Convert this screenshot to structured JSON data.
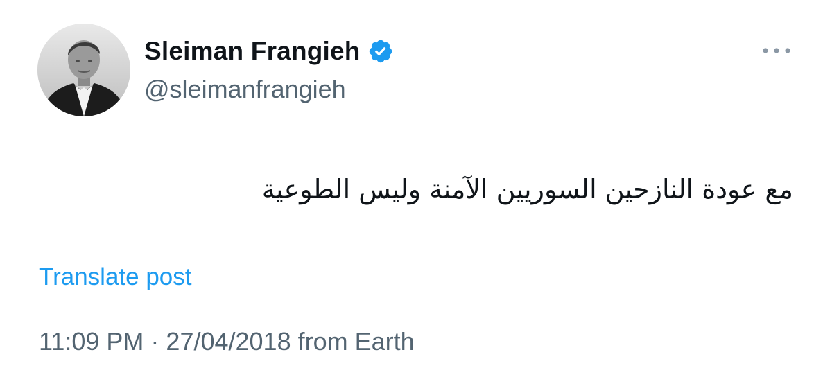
{
  "author": {
    "display_name": "Sleiman Frangieh",
    "handle": "@sleimanfrangieh",
    "verified": true
  },
  "icons": {
    "verified": "verified-badge-icon",
    "more": "more-options-icon",
    "avatar": "profile-photo"
  },
  "colors": {
    "accent": "#1d9bf0",
    "text": "#0f1419",
    "secondary_text": "#536471"
  },
  "tweet": {
    "text": "مع عودة النازحين السوريين الآمنة وليس الطوعية",
    "translate_label": "Translate post"
  },
  "meta": {
    "time": "11:09 PM",
    "separator": "·",
    "date": "27/04/2018",
    "source": "from Earth"
  }
}
